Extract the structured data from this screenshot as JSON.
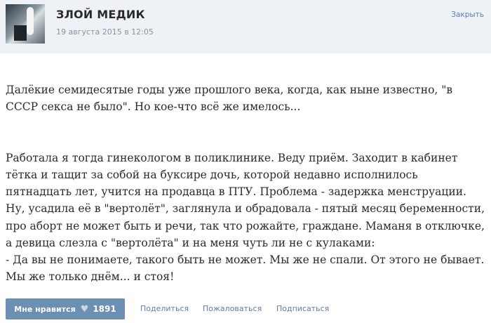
{
  "post": {
    "group_name": "ЗЛОЙ МЕДИК",
    "date": "19 августа 2015 в 12:05",
    "close_label": "Закрыть",
    "paragraph1": "Далёкие семидесятые годы уже прошлого века, когда, как ныне известно, \"в СССР секса не было\". Но кое-что всё же имелось...",
    "paragraph2": "Работала я тогда гинекологом в поликлинике. Веду приём. Заходит в кабинет тётка и тащит за собой на буксире дочь, которой недавно исполнилось пятнадцать лет, учится на продавца в ПТУ. Проблема - задержка менструации. Ну, усадила её в \"вертолёт\", заглянула и обрадовала - пятый месяц беременности, про аборт не может быть и речи, так что рожайте, граждане. Маманя в отключке, а девица слезла с \"вертолёта\" и на меня чуть ли не с кулаками:\n- Да вы не понимаете, такого быть не может. Мы же не спали. От этого не бывает. Мы же только днём... и стоя!"
  },
  "actions": {
    "like_label": "Мне нравится",
    "like_icon": "heart-icon",
    "like_count": "1891",
    "share_label": "Поделиться",
    "report_label": "Пожаловаться",
    "subscribe_label": "Подписаться"
  }
}
